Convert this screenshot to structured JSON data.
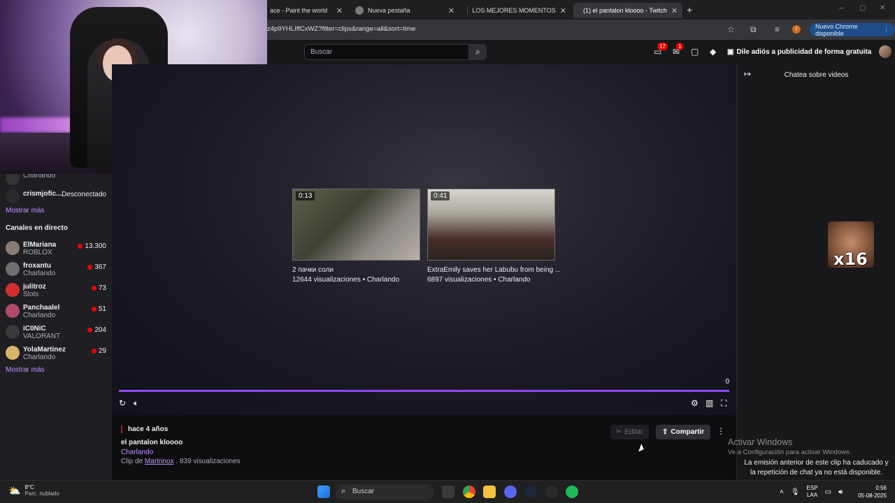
{
  "browser": {
    "tabs": [
      {
        "title": "ace - Paint the world"
      },
      {
        "title": "Nueva pestaña"
      },
      {
        "title": "LOS MEJORES MOMENTOS"
      },
      {
        "title": "(1) el pantalon kloooo - Twitch"
      }
    ],
    "url": "z4p9YHLIffCxWZ?filter=clips&range=all&sort=time",
    "new_chrome_label": "Nuevo Chrome disponible",
    "profile_letter": "I"
  },
  "twitch_nav": {
    "search_placeholder": "Buscar",
    "notifications_count": "17",
    "inbox_count": "1",
    "ad_free_label": "Dile adiós a publicidad de forma gratuita"
  },
  "sidebar": {
    "top_rows": [
      {
        "name": "",
        "sub": "Charlando",
        "status": ""
      },
      {
        "name": "crismjofic...",
        "sub": "",
        "status": "Desconectado"
      }
    ],
    "show_more_1": "Mostrar más",
    "live_header": "Canales en directo",
    "live_channels": [
      {
        "name": "ElMariana",
        "category": "ROBLOX",
        "viewers": "13.300",
        "color": "#8a7c74"
      },
      {
        "name": "froxantu",
        "category": "Charlando",
        "viewers": "367",
        "color": "#6f6f6f"
      },
      {
        "name": "julitroz",
        "category": "Slots",
        "viewers": "73",
        "color": "#d12e2e"
      },
      {
        "name": "Panchaalel",
        "category": "Charlando",
        "viewers": "51",
        "color": "#b04a6a"
      },
      {
        "name": "iC0NiC",
        "category": "VALORANT",
        "viewers": "204",
        "color": "#3a3a3a"
      },
      {
        "name": "YolaMartinez",
        "category": "Charlando",
        "viewers": "29",
        "color": "#d9b56a"
      }
    ],
    "show_more_2": "Mostrar más"
  },
  "player": {
    "clips": [
      {
        "duration": "0:13",
        "title": "2 пачки соли",
        "meta": "12644 visualizaciones • Charlando"
      },
      {
        "duration": "0:41",
        "title": "ExtraEmily saves her Labubu from being ...",
        "meta": "6897 visualizaciones • Charlando"
      }
    ],
    "counter": "0"
  },
  "clip_info": {
    "time_ago": "hace 4 años",
    "title": "el pantalon kloooo",
    "category": "Charlando",
    "clip_by_prefix": "Clip de",
    "clip_by_user": "Martrinox",
    "views_suffix": ". 839 visualizaciones",
    "edit_label": "Editar",
    "share_label": "Compartir"
  },
  "chat": {
    "title": "Chatea sobre videos",
    "sticker_text": "x16",
    "message_line1": "La emisión anterior de este clip ha caducado y",
    "message_line2": "la repetición de chat ya no está disponible."
  },
  "windows_activation": {
    "line1": "Activar Windows",
    "line2": "Ve a Configuración para activar Windows."
  },
  "taskbar": {
    "weather_temp": "8°C",
    "weather_desc": "Parc. nublado",
    "search_label": "Buscar",
    "lang_line1": "ESP",
    "lang_line2": "LAA",
    "time": "0:56",
    "date": "05-08-2025"
  }
}
